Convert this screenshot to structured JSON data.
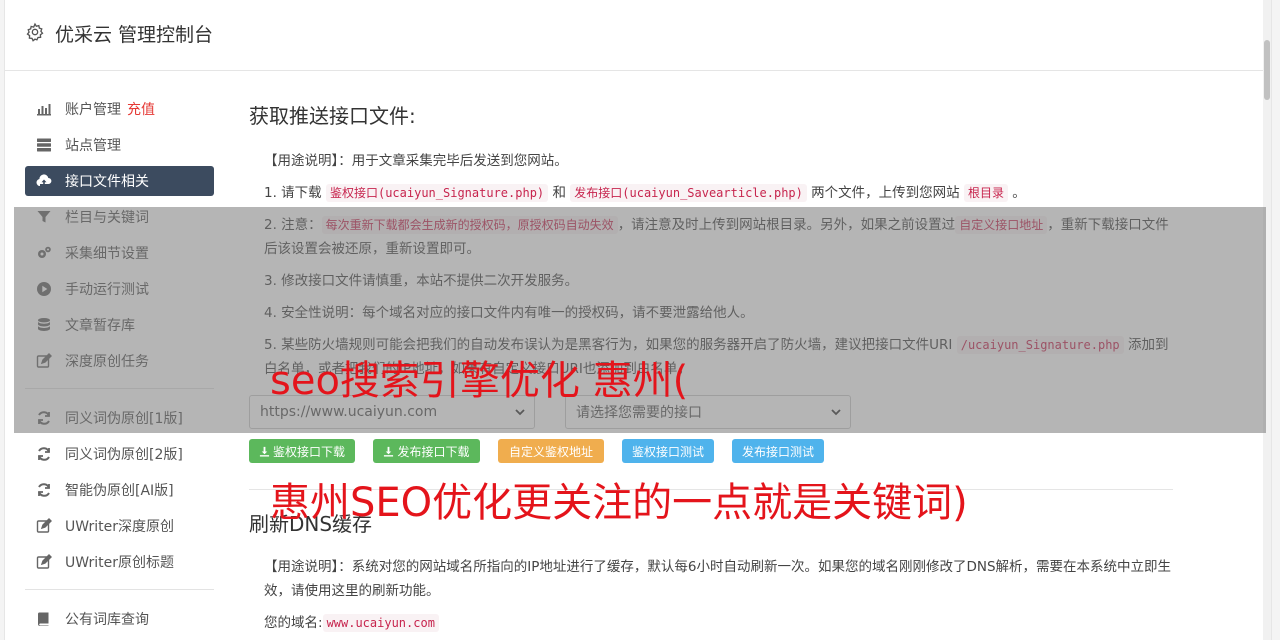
{
  "header": {
    "title": "优采云 管理控制台",
    "icon": "gear-icon"
  },
  "sidebar": {
    "items": [
      {
        "label": "账户管理",
        "badge": "充值",
        "icon": "bar-chart-icon",
        "active": false
      },
      {
        "label": "站点管理",
        "icon": "server-icon",
        "active": false
      },
      {
        "label": "接口文件相关",
        "icon": "cloud-upload-icon",
        "active": true
      },
      {
        "label": "栏目与关键词",
        "icon": "filter-icon",
        "active": false
      },
      {
        "label": "采集细节设置",
        "icon": "cogs-icon",
        "active": false
      },
      {
        "label": "手动运行测试",
        "icon": "play-circle-icon",
        "active": false
      },
      {
        "label": "文章暂存库",
        "icon": "database-icon",
        "active": false
      },
      {
        "label": "深度原创任务",
        "icon": "edit-icon",
        "active": false
      }
    ],
    "items2": [
      {
        "label": "同义词伪原创[1版]",
        "icon": "refresh-icon"
      },
      {
        "label": "同义词伪原创[2版]",
        "icon": "refresh-icon"
      },
      {
        "label": "智能伪原创[AI版]",
        "icon": "refresh-icon"
      },
      {
        "label": "UWriter深度原创",
        "icon": "edit-icon"
      },
      {
        "label": "UWriter原创标题",
        "icon": "edit-icon"
      }
    ],
    "items3": [
      {
        "label": "公有词库查询",
        "icon": "book-icon"
      }
    ]
  },
  "main": {
    "section1_title": "获取推送接口文件:",
    "usage_label": "【用途说明】",
    "usage_text": "：用于文章采集完毕后发送到您网站。",
    "step1_a": "1. 请下载 ",
    "step1_link1": "鉴权接口",
    "step1_code1": "(ucaiyun_Signature.php)",
    "step1_b": " 和 ",
    "step1_link2": "发布接口",
    "step1_code2": "(ucaiyun_Savearticle.php)",
    "step1_c": " 两个文件，上传到您网站 ",
    "step1_code3": "根目录",
    "step1_d": " 。",
    "step2_a": "2. 注意：",
    "step2_code1": "每次重新下载都会生成新的授权码，原授权码自动失效",
    "step2_b": "，请注意及时上传到网站根目录。另外，如果之前设置过",
    "step2_code2": "自定义接口地址",
    "step2_c": "，重新下载接口文件后该设置会被还原，重新设置即可。",
    "step3": "3. 修改接口文件请慎重，本站不提供二次开发服务。",
    "step4": "4. 安全性说明：每个域名对应的接口文件内有唯一的授权码，请不要泄露给他人。",
    "step5_a": "5. 某些防火墙规则可能会把我们的自动发布误认为是黑客行为，如果您的服务器开启了防火墙，建议把接口文件URI ",
    "step5_code": "/ucaiyun_Signature.php",
    "step5_b": " 添加到白名单，或者把我们的IP地址，如果有自定义接口URI也添加到白名单。",
    "select_site": "https://www.ucaiyun.com",
    "select_api": "请选择您需要的接口",
    "buttons": {
      "download_sign": "鉴权接口下载",
      "download_publish": "发布接口下载",
      "custom_sign": "自定义鉴权地址",
      "test_sign": "鉴权接口测试",
      "test_publish": "发布接口测试"
    },
    "section2_title": "刷新DNS缓存",
    "dns_usage_label": "【用途说明】",
    "dns_usage_text": "：系统对您的网站域名所指向的IP地址进行了缓存，默认每6小时自动刷新一次。如果您的域名刚刚修改了DNS解析，需要在本系统中立即生效，请使用这里的刷新功能。",
    "domain_label": "您的域名:",
    "domain_value": "www.ucaiyun.com"
  },
  "watermark": {
    "line1": "seo搜索引擎优化 惠州(",
    "line2": "惠州SEO优化更关注的一点就是关键词)"
  },
  "colors": {
    "active_nav": "#3c4b5f",
    "accent_red": "#e53935",
    "code_red": "#c7254e",
    "btn_green": "#5cb85c",
    "btn_orange": "#f0ad4e",
    "btn_blue": "#4fb3ec"
  }
}
